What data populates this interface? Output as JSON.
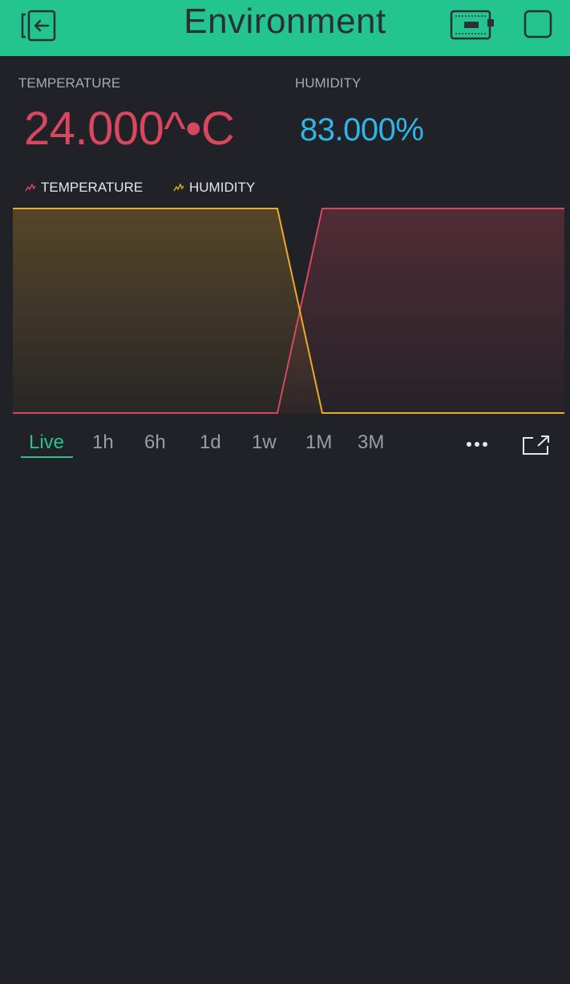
{
  "header": {
    "title": "Environment",
    "exit_icon": "exit-icon",
    "device_icon": "device-icon",
    "square_icon": "square-icon",
    "bg_color": "#23c48e"
  },
  "values": {
    "temperature": {
      "label": "TEMPERATURE",
      "value": "24.000^•C",
      "color": "#d8475d"
    },
    "humidity": {
      "label": "HUMIDITY",
      "value": "83.000%",
      "color": "#2fb6e8"
    }
  },
  "chart_data": {
    "type": "area",
    "legend": [
      {
        "name": "TEMPERATURE",
        "color": "#d8475d"
      },
      {
        "name": "HUMIDITY",
        "color": "#ecaa2a"
      }
    ],
    "x": [
      0,
      330,
      386,
      688
    ],
    "series": [
      {
        "name": "TEMPERATURE",
        "values": [
          0,
          0,
          1,
          1
        ]
      },
      {
        "name": "HUMIDITY",
        "values": [
          1,
          1,
          0,
          0
        ]
      }
    ],
    "ylim": [
      0,
      1
    ],
    "grid": false
  },
  "time_ranges": {
    "items": [
      "Live",
      "1h",
      "6h",
      "1d",
      "1w",
      "1M",
      "3M"
    ],
    "active": "Live",
    "more_icon": "more-icon",
    "expand_icon": "expand-icon"
  }
}
